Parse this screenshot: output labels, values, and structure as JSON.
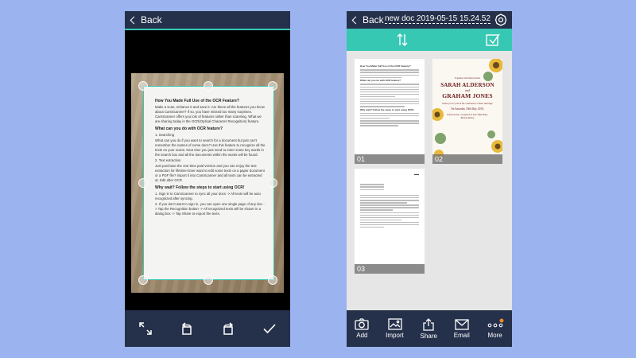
{
  "left_screen": {
    "back_label": "Back",
    "document": {
      "heading1": "How You Made Full Use of the OCR Feature?",
      "intro": "Make a scan, enhance it and save it. Are these all the features you know about CamScanner? If so, you have missed too many surprises. CamScanner offers you lots of features rather than scanning. What we are sharing today is the OCR(Optical Character Recognition) feature.",
      "heading2": "What can you do with OCR feature?",
      "item1_title": "1. Searching",
      "item1_text": "What can you do if you want to search for a document but just can't remember the names of some docs? Use this feature to recognize all the texts on your scans. Next time you just need to enter some key words in the search box and all the documents within the words will be found.",
      "item2_title": "2. Text extraction",
      "item2_text": "Just purchase the one-time paid version and you can enjoy the text extraction for lifetime! Ever want to edit some texts on a paper document or a PDF file? Import it into CamScanner and all texts can be extracted at. Edit after OCR",
      "heading3": "Why wait? Follow the steps to start using OCR!",
      "step1": "1. Sign in to CamScanner to sync all your docs -> All texts will be auto recognized after syncing.",
      "step2": "2. If you don't want to sign in, you can open one single page of any doc -> Tap the Recognition button -> All recognized texts will be shown in a dialog box -> Tap Share to export the texts."
    },
    "toolbar_icons": [
      "expand-icon",
      "rotate-left-icon",
      "rotate-right-icon",
      "checkmark-icon"
    ]
  },
  "right_screen": {
    "back_label": "Back",
    "title": "new doc 2019-05-15 15.24.52",
    "pages": [
      {
        "number": "01",
        "heading": "How You Made Full Use of the OCR Feature?",
        "subheading": "What can you do with OCR feature?",
        "subheading2": "Why wait? Follow the steps to start using OCR!"
      },
      {
        "number": "02",
        "script_line": "Together with their parents",
        "name1": "SARAH ALDERSON",
        "conjunction": "and",
        "name2": "GRAHAM JONES",
        "invite_text": "Invite you to join in the celebration of their marriage",
        "date": "On Saturday 18th May 2019,",
        "reception": "Followed by a reception at The Tithe Barn, Bolton Abbey"
      },
      {
        "number": "03"
      }
    ],
    "bottom_bar": [
      {
        "label": "Add",
        "icon": "camera-icon"
      },
      {
        "label": "Import",
        "icon": "import-image-icon"
      },
      {
        "label": "Share",
        "icon": "share-icon"
      },
      {
        "label": "Email",
        "icon": "email-icon"
      },
      {
        "label": "More",
        "icon": "more-icon"
      }
    ],
    "colors": {
      "accent": "#37c8b4",
      "bar": "#25304a",
      "badge": "#f08a24"
    }
  }
}
